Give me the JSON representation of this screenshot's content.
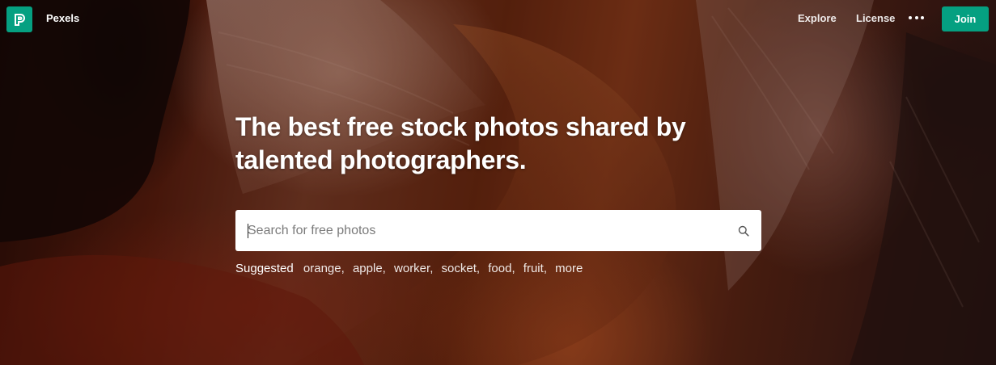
{
  "nav": {
    "brand": "Pexels",
    "links": [
      "Explore",
      "License"
    ],
    "join_label": "Join"
  },
  "hero": {
    "headline_line1": "The best free stock photos shared by",
    "headline_line2": "talented photographers."
  },
  "search": {
    "placeholder": "Search for free photos",
    "value": ""
  },
  "suggested": {
    "label": "Suggested",
    "items": [
      "orange",
      "apple",
      "worker",
      "socket",
      "food",
      "fruit",
      "more"
    ]
  },
  "colors": {
    "brand_green": "#05a081",
    "text": "#ffffff"
  },
  "icons": {
    "logo": "pexels-logo-icon",
    "more": "more-dots-icon",
    "search": "search-icon"
  }
}
